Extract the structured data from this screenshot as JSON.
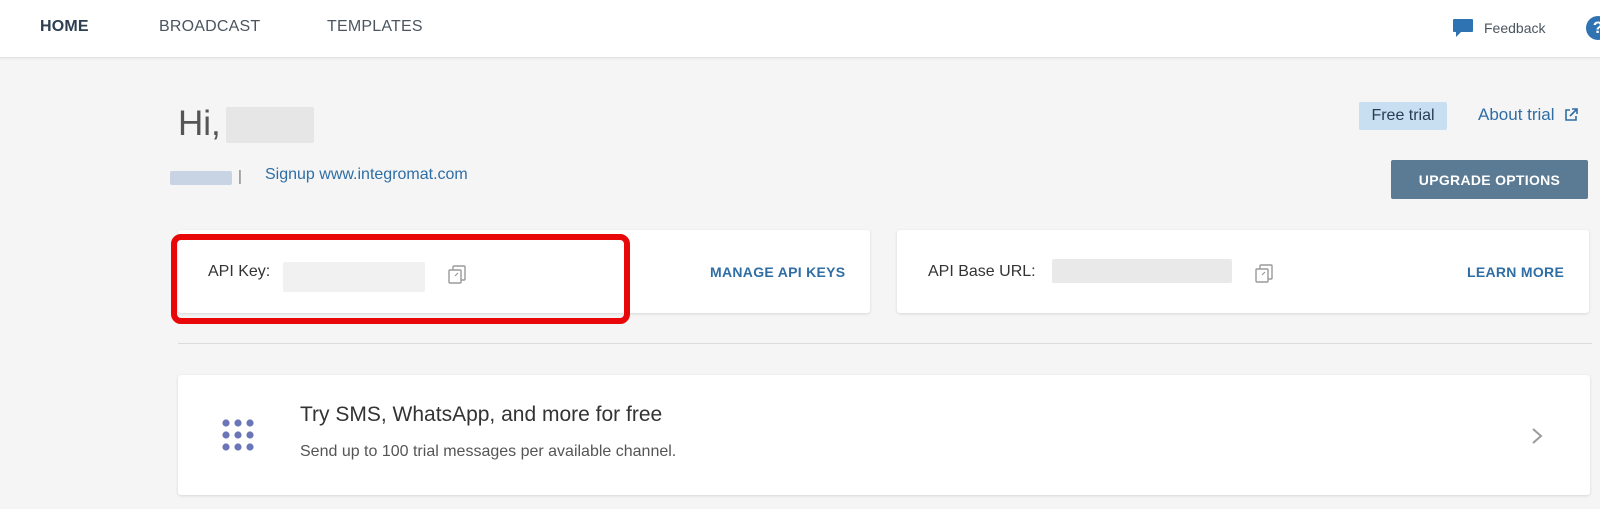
{
  "nav": {
    "tabs": [
      {
        "label": "HOME",
        "active": true
      },
      {
        "label": "BROADCAST",
        "active": false
      },
      {
        "label": "TEMPLATES",
        "active": false
      }
    ],
    "feedback_label": "Feedback",
    "feedback_icon": "chat-bubble-icon",
    "help_icon": "question-circle-icon",
    "help_glyph": "?"
  },
  "header": {
    "greeting": "Hi,",
    "account_separator": "|",
    "signup_link": "Signup www.integromat.com"
  },
  "trial": {
    "badge": "Free trial",
    "about_link": "About trial",
    "about_icon": "external-link-icon",
    "upgrade_button": "UPGRADE OPTIONS"
  },
  "api_key_card": {
    "label": "API Key:",
    "copy_icon": "copy-icon",
    "link": "MANAGE API KEYS"
  },
  "api_url_card": {
    "label": "API Base URL:",
    "copy_icon": "copy-icon",
    "link": "LEARN MORE"
  },
  "promo": {
    "icon": "dots-grid-icon",
    "title": "Try SMS, WhatsApp, and more for free",
    "subtitle": "Send up to 100 trial messages per available channel.",
    "chevron": "chevron-right-icon"
  },
  "colors": {
    "accent_link": "#2f6ea5",
    "upgrade_button": "#5b7a93",
    "trial_badge": "#c7dff0",
    "highlight": "#e8080a",
    "dots_icon": "#6b76b8"
  }
}
